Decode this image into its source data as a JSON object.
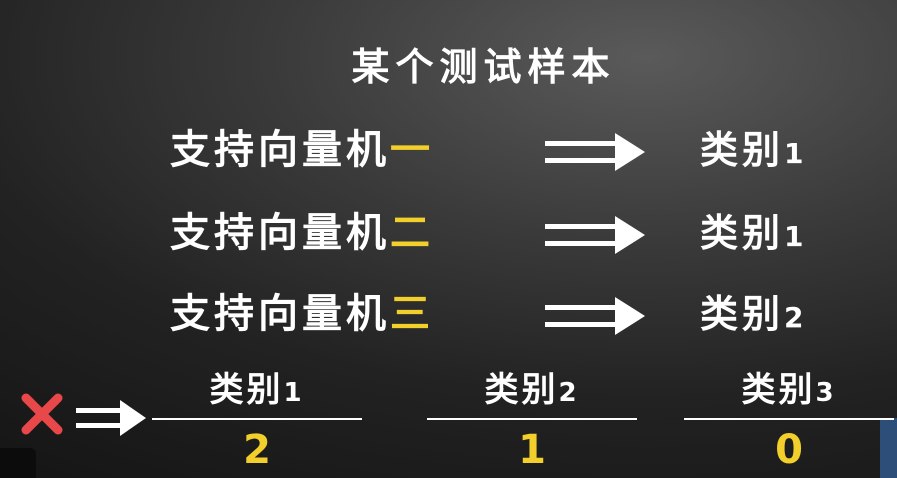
{
  "title": "某个测试样本",
  "rows": [
    {
      "label": "支持向量机",
      "num": "一",
      "result_label": "类别",
      "result_num": "1"
    },
    {
      "label": "支持向量机",
      "num": "二",
      "result_label": "类别",
      "result_num": "1"
    },
    {
      "label": "支持向量机",
      "num": "三",
      "result_label": "类别",
      "result_num": "2"
    }
  ],
  "tally": [
    {
      "label": "类别",
      "num": "1",
      "value": "2"
    },
    {
      "label": "类别",
      "num": "2",
      "value": "1"
    },
    {
      "label": "类别",
      "num": "3",
      "value": "0"
    }
  ],
  "colors": {
    "highlight": "#f2cf2a",
    "x_mark": "#e8484a",
    "text": "#ffffff"
  },
  "icons": {
    "mark": "x-icon",
    "arrow": "double-arrow-right-icon"
  }
}
